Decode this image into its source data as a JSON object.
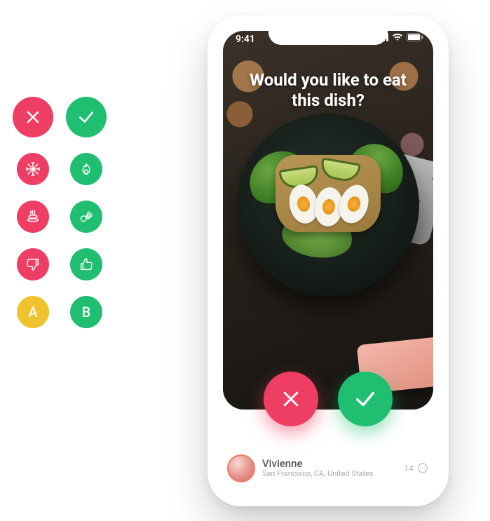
{
  "palette": {
    "red": "#ef3e63",
    "green": "#1fbe70",
    "yellow": "#f0c32e"
  },
  "icon_grid": {
    "rows": [
      {
        "left": {
          "name": "reject-icon",
          "color": "red",
          "glyph": "cross"
        },
        "right": {
          "name": "accept-icon",
          "color": "green",
          "glyph": "check"
        }
      },
      {
        "left": {
          "name": "cold-icon",
          "color": "red",
          "glyph": "snowflake"
        },
        "right": {
          "name": "hot-icon",
          "color": "green",
          "glyph": "flame"
        }
      },
      {
        "left": {
          "name": "bad-dish-icon",
          "color": "red",
          "glyph": "steaming-poo"
        },
        "right": {
          "name": "ok-gesture-icon",
          "color": "green",
          "glyph": "ok-hand"
        }
      },
      {
        "left": {
          "name": "thumbs-down-icon",
          "color": "red",
          "glyph": "thumbs-down"
        },
        "right": {
          "name": "thumbs-up-icon",
          "color": "green",
          "glyph": "thumbs-up"
        }
      },
      {
        "left": {
          "name": "option-a-icon",
          "color": "yellow",
          "letter": "A"
        },
        "right": {
          "name": "option-b-icon",
          "color": "green",
          "letter": "B"
        }
      }
    ]
  },
  "phone": {
    "status_time": "9:41",
    "question": "Would you like to eat this dish?",
    "actions": {
      "reject_name": "reject-dish-button",
      "accept_name": "accept-dish-button"
    },
    "user": {
      "name": "Vivienne",
      "location": "San Francisco, CA, United States",
      "comment_count": "14"
    }
  }
}
